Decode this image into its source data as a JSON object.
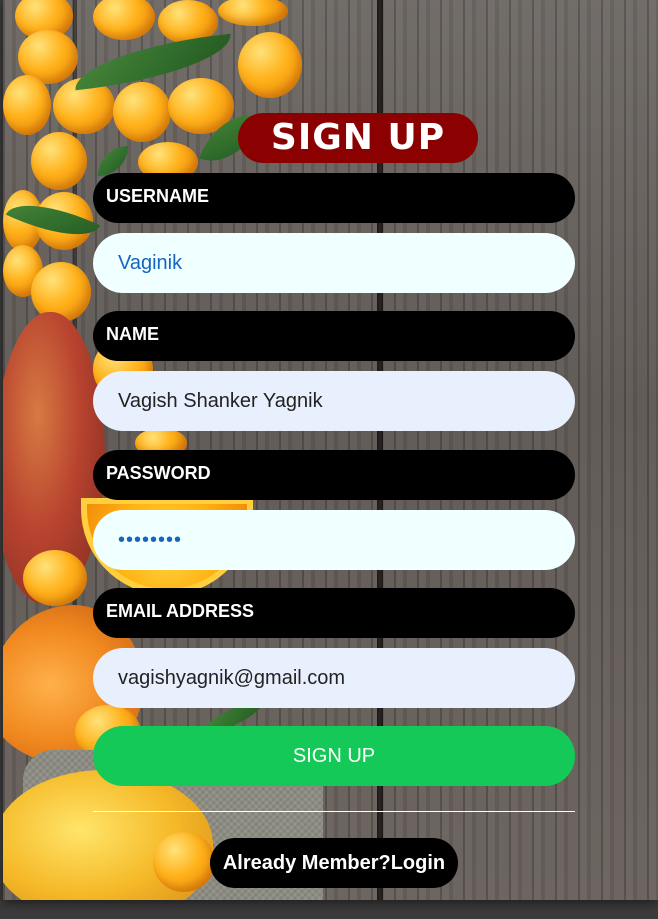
{
  "form": {
    "title": "SIGN UP",
    "username_label": "USERNAME",
    "username_value": "Vaginik",
    "name_label": "NAME",
    "name_value": "Vagish Shanker Yagnik",
    "password_label": "PASSWORD",
    "password_value": "vaginik1",
    "email_label": "EMAIL ADDRESS",
    "email_value": "vagishyagnik@gmail.com",
    "submit_label": "SIGN UP",
    "login_link": "Already Member?Login"
  },
  "colors": {
    "title_bg": "#8b0000",
    "label_bg": "#000000",
    "submit_bg": "#14c957",
    "field_blue_bg": "#f0ffff",
    "field_grey_bg": "#e8f0fe"
  }
}
